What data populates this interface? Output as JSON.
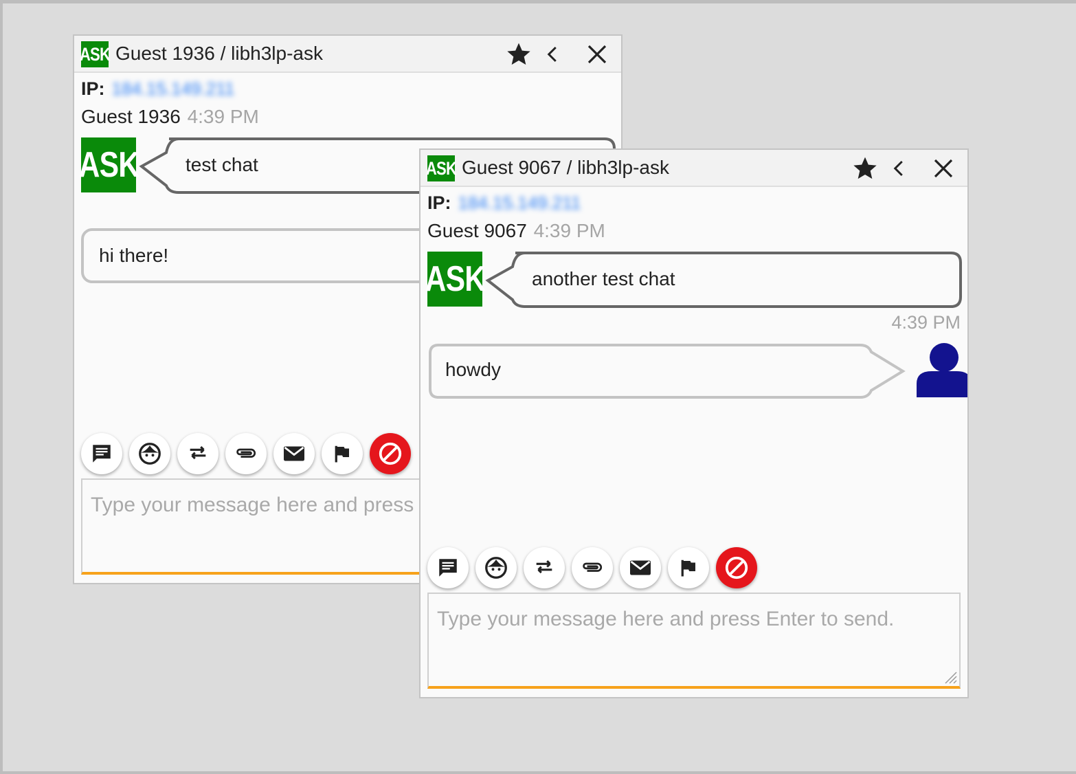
{
  "windows": [
    {
      "logo": "ASK",
      "guest_name": "Guest 1936",
      "separator": "/",
      "queue": "libh3lp-ask",
      "ip_label": "IP:",
      "ip_value": "184.15.149.211",
      "header_time": "4:39 PM",
      "messages": [
        {
          "from": "patron",
          "text": "test chat"
        },
        {
          "from": "librarian",
          "text": "hi there!"
        }
      ],
      "composer_placeholder": "Type your message here and press Enter to send.",
      "toolbar_icons": [
        "canned-message-icon",
        "face-icon",
        "transfer-icon",
        "attachment-icon",
        "email-icon",
        "flag-icon",
        "block-icon"
      ],
      "titlebar_icons": [
        "star-icon",
        "back-icon",
        "close-icon"
      ]
    },
    {
      "logo": "ASK",
      "guest_name": "Guest 9067",
      "separator": "/",
      "queue": "libh3lp-ask",
      "ip_label": "IP:",
      "ip_value": "184.15.149.211",
      "header_time": "4:39 PM",
      "reply_time": "4:39 PM",
      "messages": [
        {
          "from": "patron",
          "text": "another test chat"
        },
        {
          "from": "librarian",
          "text": "howdy"
        }
      ],
      "composer_placeholder": "Type your message here and press Enter to send.",
      "toolbar_icons": [
        "canned-message-icon",
        "face-icon",
        "transfer-icon",
        "attachment-icon",
        "email-icon",
        "flag-icon",
        "block-icon"
      ],
      "titlebar_icons": [
        "star-icon",
        "back-icon",
        "close-icon"
      ]
    }
  ],
  "colors": {
    "logo_green": "#0a8a0a",
    "composer_accent": "#f7a21b",
    "block_red": "#e5161c",
    "avatar_blue": "#13138f",
    "ip_blue": "#2a7df5"
  }
}
